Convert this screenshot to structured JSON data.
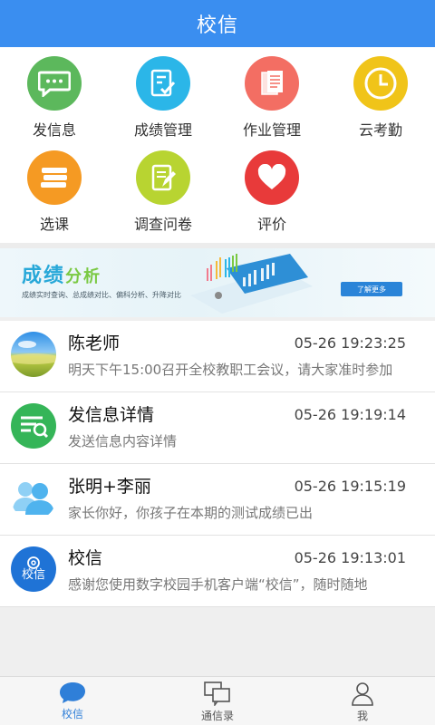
{
  "header": {
    "title": "校信",
    "color": "#3a8ef0"
  },
  "grid": {
    "items": [
      {
        "label": "发信息",
        "icon": "chat-icon",
        "color": "#5cb85c"
      },
      {
        "label": "成绩管理",
        "icon": "report-icon",
        "color": "#2bb6e8"
      },
      {
        "label": "作业管理",
        "icon": "documents-icon",
        "color": "#f36e63"
      },
      {
        "label": "云考勤",
        "icon": "clock-icon",
        "color": "#f0c419"
      },
      {
        "label": "选课",
        "icon": "books-icon",
        "color": "#f59a23"
      },
      {
        "label": "调查问卷",
        "icon": "survey-icon",
        "color": "#b8d431"
      },
      {
        "label": "评价",
        "icon": "heart-icon",
        "color": "#e83a3a"
      }
    ]
  },
  "banner": {
    "title_part1": "成绩",
    "title_part2": "分析",
    "subtitle": "成绩实时查询、总成绩对比、偏科分析、升降对比",
    "button": "了解更多"
  },
  "messages": [
    {
      "name": "陈老师",
      "time": "05-26 19:23:25",
      "preview": "明天下午15:00召开全校教职工会议，请大家准时参加",
      "avatar": "landscape-avatar"
    },
    {
      "name": "发信息详情",
      "time": "05-26 19:19:14",
      "preview": "发送信息内容详情",
      "avatar": "message-detail-icon"
    },
    {
      "name": "张明+李丽",
      "time": "05-26 19:15:19",
      "preview": "家长你好，你孩子在本期的测试成绩已出",
      "avatar": "group-icon"
    },
    {
      "name": "校信",
      "time": "05-26 19:13:01",
      "preview": "感谢您使用数字校园手机客户端“校信”，随时随地",
      "avatar": "school-logo-icon",
      "avatar_text": "校信"
    }
  ],
  "tabs": [
    {
      "label": "校信",
      "icon": "chat-bubble-icon",
      "active": true
    },
    {
      "label": "通信录",
      "icon": "contacts-icon",
      "active": false
    },
    {
      "label": "我",
      "icon": "person-icon",
      "active": false
    }
  ],
  "colors": {
    "accent": "#3a8ef0",
    "tab_active": "#2f7fd8"
  }
}
